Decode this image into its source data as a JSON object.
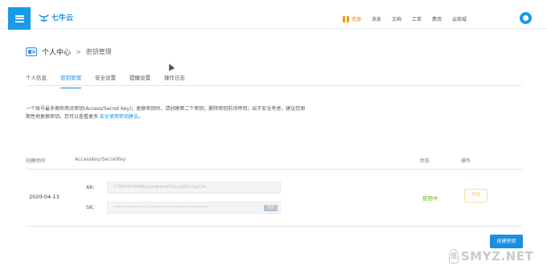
{
  "header": {
    "logo_text": "七牛云",
    "nav": {
      "resources": "资源",
      "messages": "消息",
      "docs": "文档",
      "tickets": "工单",
      "billing": "费用",
      "cloud_market": "云商城"
    }
  },
  "breadcrumb": {
    "section": "个人中心",
    "separator": ">",
    "current": "密钥管理"
  },
  "tabs": [
    "个人信息",
    "密钥管理",
    "安全设置",
    "提醒设置",
    "操作日志"
  ],
  "active_tab": "密钥管理",
  "description": {
    "text": "一个账号最多拥有两对密钥(Access/Secret Key)；更换密钥时，请创建第二个密钥；删除密钥前须停用；出于安全考虑，建议您周期性地更换密钥。您可以查看更多 ",
    "link": "安全使用密钥建议",
    "suffix": "。"
  },
  "table": {
    "headers": {
      "created_time": "创建时间",
      "keys": "AccessKey/SecretKey",
      "status": "状态",
      "action": "操作"
    },
    "row": {
      "created": "2020-04-13",
      "ak_label": "AK:",
      "ak_value": "CTMEDZHSKNRzjvbUBokmJCttvuz980LIVjy1Ax",
      "sk_label": "SK:",
      "sk_value": "••••••••••••••••••••••••••••••••••••••••",
      "show_label": "显示",
      "status": "使用中",
      "action": "停用"
    }
  },
  "create_button": "创建密钥",
  "watermark": {
    "badge": "值",
    "text": "SMYZ.NET"
  },
  "colors": {
    "brand": "#1a8fe0",
    "status_active": "#52c41a",
    "disable_border": "#f7dca1",
    "resource_accent": "#e8891d"
  }
}
